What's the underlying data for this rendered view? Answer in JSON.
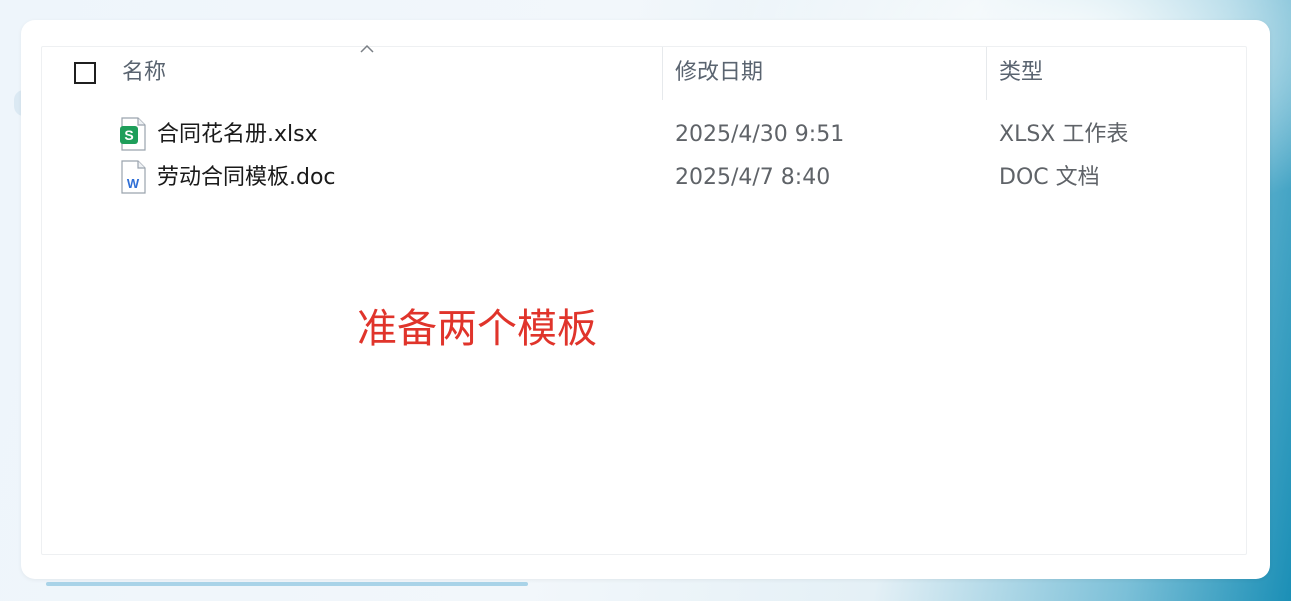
{
  "header": {
    "select_all": "",
    "columns": {
      "name": "名称",
      "date": "修改日期",
      "type": "类型"
    },
    "sort_icon": "chevron-up-icon"
  },
  "files": [
    {
      "name": "合同花名册.xlsx",
      "date": "2025/4/30 9:51",
      "type": "XLSX 工作表",
      "icon": "spreadsheet-file-icon",
      "icon_letter": "S",
      "icon_color": "#1e9e5a"
    },
    {
      "name": "劳动合同模板.doc",
      "date": "2025/4/7 8:40",
      "type": "DOC 文档",
      "icon": "word-document-file-icon",
      "icon_letter": "W",
      "icon_color": "#2f6fd6"
    }
  ],
  "annotation": {
    "text": "准备两个模板",
    "color": "#e0342b"
  }
}
